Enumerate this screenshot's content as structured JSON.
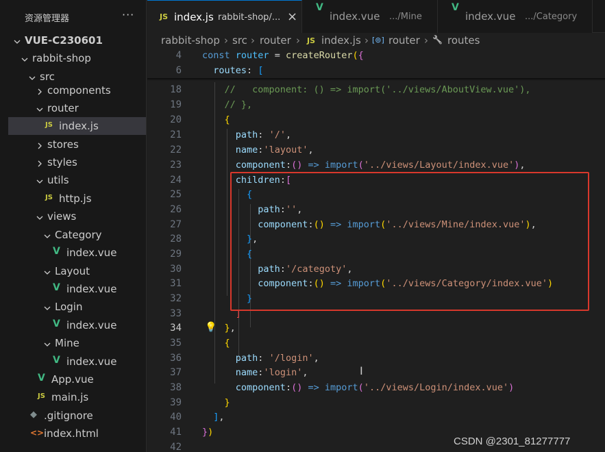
{
  "explorer": {
    "title": "资源管理器",
    "more": "···",
    "items": [
      {
        "label": "VUE-C230601",
        "kind": "folder-open",
        "bold": true
      },
      {
        "label": "rabbit-shop",
        "kind": "folder-open"
      },
      {
        "label": "src",
        "kind": "folder-open"
      },
      {
        "label": "components",
        "kind": "folder-closed"
      },
      {
        "label": "router",
        "kind": "folder-open"
      },
      {
        "label": "index.js",
        "kind": "js",
        "icon": "JS",
        "selected": true
      },
      {
        "label": "stores",
        "kind": "folder-closed"
      },
      {
        "label": "styles",
        "kind": "folder-closed"
      },
      {
        "label": "utils",
        "kind": "folder-open"
      },
      {
        "label": "http.js",
        "kind": "js",
        "icon": "JS"
      },
      {
        "label": "views",
        "kind": "folder-open"
      },
      {
        "label": "Category",
        "kind": "folder-open"
      },
      {
        "label": "index.vue",
        "kind": "vue",
        "icon": "V"
      },
      {
        "label": "Layout",
        "kind": "folder-open"
      },
      {
        "label": "index.vue",
        "kind": "vue",
        "icon": "V"
      },
      {
        "label": "Login",
        "kind": "folder-open"
      },
      {
        "label": "index.vue",
        "kind": "vue",
        "icon": "V"
      },
      {
        "label": "Mine",
        "kind": "folder-open"
      },
      {
        "label": "index.vue",
        "kind": "vue",
        "icon": "V"
      },
      {
        "label": "App.vue",
        "kind": "vue",
        "icon": "V"
      },
      {
        "label": "main.js",
        "kind": "js",
        "icon": "JS"
      },
      {
        "label": ".gitignore",
        "kind": "git",
        "icon": "◆"
      },
      {
        "label": "index.html",
        "kind": "html",
        "icon": "<>"
      }
    ]
  },
  "tabs": [
    {
      "icon": "JS",
      "name": "index.js",
      "path": "rabbit-shop/...",
      "close": "×",
      "active": true
    },
    {
      "icon": "V",
      "name": "index.vue",
      "path": ".../Mine"
    },
    {
      "icon": "V",
      "name": "index.vue",
      "path": ".../Category"
    }
  ],
  "breadcrumb": {
    "parts": [
      "rabbit-shop",
      "src",
      "router"
    ],
    "file": "index.js",
    "file_icon": "JS",
    "symbol1": "router",
    "symbol1_icon": "[⊚]",
    "symbol2": "routes",
    "symbol2_icon": "🔧"
  },
  "editor": {
    "current_line": 34,
    "lines": [
      {
        "n": 4,
        "tokens": [
          [
            "kw",
            "const "
          ],
          [
            "var",
            "router"
          ],
          [
            "pl",
            " = "
          ],
          [
            "fn",
            "createRouter"
          ],
          [
            "p1",
            "("
          ],
          [
            "p2",
            "{"
          ]
        ]
      },
      {
        "n": 6,
        "tokens": [
          [
            "pl",
            "  "
          ],
          [
            "prop",
            "routes"
          ],
          [
            "pl",
            ": "
          ],
          [
            "p3",
            "["
          ]
        ]
      },
      {
        "n": 18,
        "tokens": [
          [
            "com",
            "    //   component: () => import('../views/AboutView.vue'),"
          ]
        ]
      },
      {
        "n": 19,
        "tokens": [
          [
            "com",
            "    // },"
          ]
        ]
      },
      {
        "n": 20,
        "tokens": [
          [
            "pl",
            "    "
          ],
          [
            "p1",
            "{"
          ]
        ]
      },
      {
        "n": 21,
        "tokens": [
          [
            "pl",
            "      "
          ],
          [
            "prop",
            "path"
          ],
          [
            "pl",
            ": "
          ],
          [
            "str",
            "'/'"
          ],
          [
            "pl",
            ","
          ]
        ]
      },
      {
        "n": 22,
        "tokens": [
          [
            "pl",
            "      "
          ],
          [
            "prop",
            "name"
          ],
          [
            "pl",
            ":"
          ],
          [
            "str",
            "'layout'"
          ],
          [
            "pl",
            ","
          ]
        ]
      },
      {
        "n": 23,
        "tokens": [
          [
            "pl",
            "      "
          ],
          [
            "prop",
            "component"
          ],
          [
            "pl",
            ":"
          ],
          [
            "p2",
            "()"
          ],
          [
            "pl",
            " "
          ],
          [
            "kw",
            "=>"
          ],
          [
            "pl",
            " "
          ],
          [
            "kw",
            "import"
          ],
          [
            "p2",
            "("
          ],
          [
            "str",
            "'../views/Layout/index.vue'"
          ],
          [
            "p2",
            ")"
          ],
          [
            "pl",
            ","
          ]
        ]
      },
      {
        "n": 24,
        "tokens": [
          [
            "pl",
            "      "
          ],
          [
            "prop",
            "children"
          ],
          [
            "pl",
            ":"
          ],
          [
            "p2",
            "["
          ]
        ]
      },
      {
        "n": 25,
        "tokens": [
          [
            "pl",
            "        "
          ],
          [
            "p3",
            "{"
          ]
        ]
      },
      {
        "n": 26,
        "tokens": [
          [
            "pl",
            "          "
          ],
          [
            "prop",
            "path"
          ],
          [
            "pl",
            ":"
          ],
          [
            "str",
            "''"
          ],
          [
            "pl",
            ","
          ]
        ]
      },
      {
        "n": 27,
        "tokens": [
          [
            "pl",
            "          "
          ],
          [
            "prop",
            "component"
          ],
          [
            "pl",
            ":"
          ],
          [
            "p1",
            "()"
          ],
          [
            "pl",
            " "
          ],
          [
            "kw",
            "=>"
          ],
          [
            "pl",
            " "
          ],
          [
            "kw",
            "import"
          ],
          [
            "p1",
            "("
          ],
          [
            "str",
            "'../views/Mine/index.vue'"
          ],
          [
            "p1",
            ")"
          ],
          [
            "pl",
            ","
          ]
        ]
      },
      {
        "n": 28,
        "tokens": [
          [
            "pl",
            "        "
          ],
          [
            "p3",
            "}"
          ],
          [
            "pl",
            ","
          ]
        ]
      },
      {
        "n": 29,
        "tokens": [
          [
            "pl",
            "        "
          ],
          [
            "p3",
            "{"
          ]
        ]
      },
      {
        "n": 30,
        "tokens": [
          [
            "pl",
            "          "
          ],
          [
            "prop",
            "path"
          ],
          [
            "pl",
            ":"
          ],
          [
            "str",
            "'/categoty'"
          ],
          [
            "pl",
            ","
          ]
        ]
      },
      {
        "n": 31,
        "tokens": [
          [
            "pl",
            "          "
          ],
          [
            "prop",
            "component"
          ],
          [
            "pl",
            ":"
          ],
          [
            "p1",
            "()"
          ],
          [
            "pl",
            " "
          ],
          [
            "kw",
            "=>"
          ],
          [
            "pl",
            " "
          ],
          [
            "kw",
            "import"
          ],
          [
            "p1",
            "("
          ],
          [
            "str",
            "'../views/Category/index.vue'"
          ],
          [
            "p1",
            ")"
          ]
        ]
      },
      {
        "n": 32,
        "tokens": [
          [
            "pl",
            "        "
          ],
          [
            "p3",
            "}"
          ]
        ]
      },
      {
        "n": 33,
        "tokens": [
          [
            "pl",
            "      "
          ],
          [
            "err",
            "]"
          ]
        ]
      },
      {
        "n": 34,
        "tokens": [
          [
            "pl",
            "    "
          ],
          [
            "p1",
            "}"
          ],
          [
            "pl",
            ","
          ]
        ]
      },
      {
        "n": 35,
        "tokens": [
          [
            "pl",
            "    "
          ],
          [
            "p1",
            "{"
          ]
        ]
      },
      {
        "n": 36,
        "tokens": [
          [
            "pl",
            "      "
          ],
          [
            "prop",
            "path"
          ],
          [
            "pl",
            ": "
          ],
          [
            "str",
            "'/login'"
          ],
          [
            "pl",
            ","
          ]
        ]
      },
      {
        "n": 37,
        "tokens": [
          [
            "pl",
            "      "
          ],
          [
            "prop",
            "name"
          ],
          [
            "pl",
            ":"
          ],
          [
            "str",
            "'login'"
          ],
          [
            "pl",
            ","
          ]
        ]
      },
      {
        "n": 38,
        "tokens": [
          [
            "pl",
            "      "
          ],
          [
            "prop",
            "component"
          ],
          [
            "pl",
            ":"
          ],
          [
            "p2",
            "()"
          ],
          [
            "pl",
            " "
          ],
          [
            "kw",
            "=>"
          ],
          [
            "pl",
            " "
          ],
          [
            "kw",
            "import"
          ],
          [
            "p2",
            "("
          ],
          [
            "str",
            "'../views/Login/index.vue'"
          ],
          [
            "p2",
            ")"
          ]
        ]
      },
      {
        "n": 39,
        "tokens": [
          [
            "pl",
            "    "
          ],
          [
            "p1",
            "}"
          ]
        ]
      },
      {
        "n": 40,
        "tokens": [
          [
            "pl",
            "  "
          ],
          [
            "p3",
            "]"
          ],
          [
            "pl",
            ","
          ]
        ]
      },
      {
        "n": 41,
        "tokens": [
          [
            "p2",
            "}"
          ],
          [
            "p1",
            ")"
          ]
        ]
      },
      {
        "n": 42,
        "tokens": []
      }
    ]
  },
  "watermark": "CSDN @2301_81277777"
}
